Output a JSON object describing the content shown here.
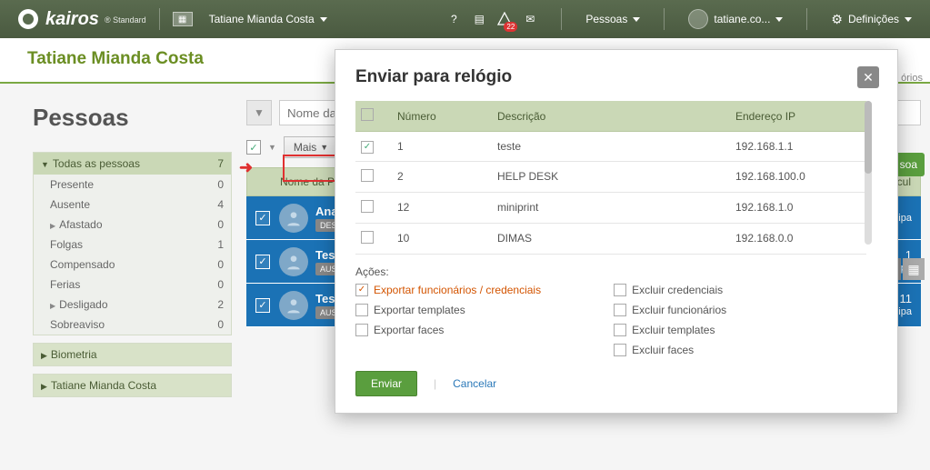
{
  "topbar": {
    "logo_text": "kairos",
    "logo_sub": "® Standard",
    "user_crumb": "Tatiane Mianda Costa",
    "alert_count": "22",
    "pessoas_link": "Pessoas",
    "account": "tatiane.co...",
    "settings": "Definições"
  },
  "page": {
    "title": "Tatiane Mianda Costa",
    "section": "Pessoas",
    "relatorios": "órios"
  },
  "sidebar": {
    "groups": [
      {
        "label": "Todas as pessoas",
        "count": "7",
        "items": [
          {
            "label": "Presente",
            "count": "0"
          },
          {
            "label": "Ausente",
            "count": "4"
          },
          {
            "label": "Afastado",
            "count": "0",
            "sub": true
          },
          {
            "label": "Folgas",
            "count": "1"
          },
          {
            "label": "Compensado",
            "count": "0"
          },
          {
            "label": "Ferias",
            "count": "0"
          },
          {
            "label": "Desligado",
            "count": "2",
            "sub": true
          },
          {
            "label": "Sobreaviso",
            "count": "0"
          }
        ]
      },
      {
        "label": "Biometria"
      },
      {
        "label": "Tatiane Mianda Costa"
      }
    ]
  },
  "main": {
    "search_placeholder": "Nome da Pessoa",
    "mais_btn": "Mais",
    "grid_head_name": "Nome da Pesso",
    "grid_head_matric": "Matricul",
    "rows": [
      {
        "name": "Ana S",
        "status": "DESLIG",
        "right_top": "",
        "right_bot": "Principa"
      },
      {
        "name": "Teste",
        "status": "AUSENT",
        "right_top": "1",
        "right_bot": "Principa"
      },
      {
        "name": "Teste",
        "status": "AUSENTE",
        "right_top": "11",
        "right_bot": "Principa"
      }
    ],
    "pessoa_btn": "soa"
  },
  "modal": {
    "title": "Enviar para relógio",
    "columns": {
      "num": "Número",
      "desc": "Descrição",
      "ip": "Endereço IP"
    },
    "rows": [
      {
        "checked": true,
        "num": "1",
        "desc": "teste",
        "ip": "192.168.1.1"
      },
      {
        "checked": false,
        "num": "2",
        "desc": "HELP DESK",
        "ip": "192.168.100.0"
      },
      {
        "checked": false,
        "num": "12",
        "desc": "miniprint",
        "ip": "192.168.1.0"
      },
      {
        "checked": false,
        "num": "10",
        "desc": "DIMAS",
        "ip": "192.168.0.0"
      }
    ],
    "actions_label": "Ações:",
    "actions_left": [
      {
        "label": "Exportar funcionários / credenciais",
        "checked": true,
        "highlight": true
      },
      {
        "label": "Exportar templates",
        "checked": false
      },
      {
        "label": "Exportar faces",
        "checked": false
      }
    ],
    "actions_right": [
      {
        "label": "Excluir credenciais",
        "checked": false
      },
      {
        "label": "Excluir funcionários",
        "checked": false
      },
      {
        "label": "Excluir templates",
        "checked": false
      },
      {
        "label": "Excluir faces",
        "checked": false
      }
    ],
    "send": "Enviar",
    "cancel": "Cancelar"
  }
}
